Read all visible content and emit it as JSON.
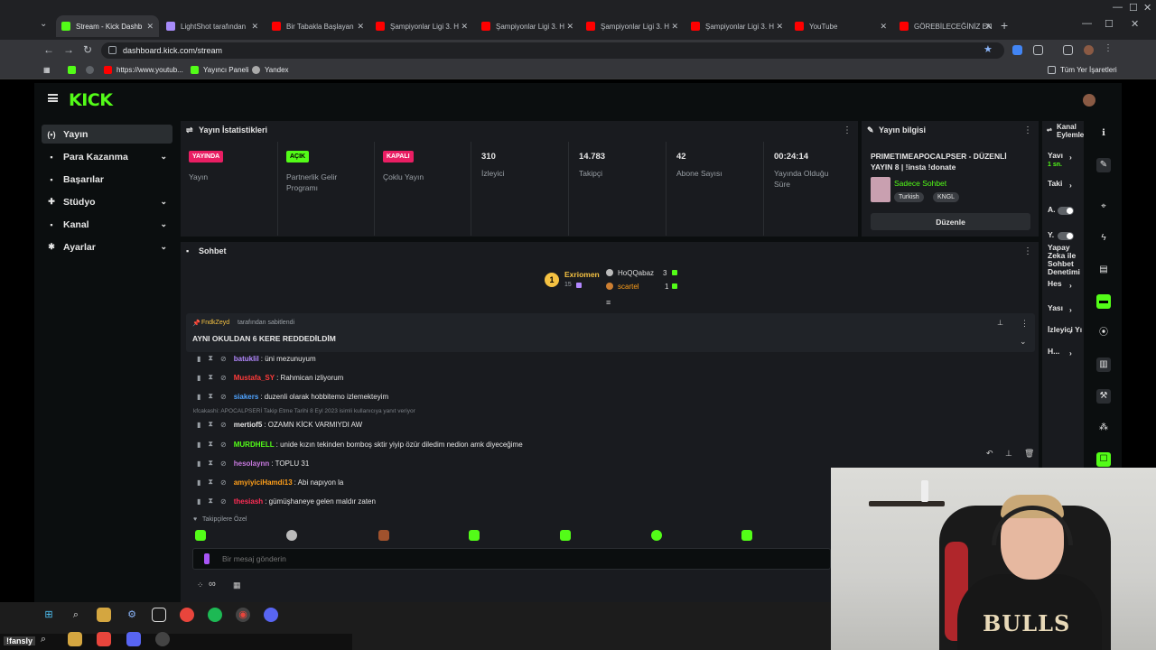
{
  "browser": {
    "tabs": [
      {
        "title": "Stream - Kick Dashb",
        "color": "#53fc18",
        "active": true
      },
      {
        "title": "LightShot tarafından",
        "color": "#a78bfa",
        "active": false
      },
      {
        "title": "Bir Tabakla Başlayan",
        "color": "#ff0000",
        "active": false
      },
      {
        "title": "Şampiyonlar Ligi 3. H",
        "color": "#ff0000",
        "active": false
      },
      {
        "title": "Şampiyonlar Ligi 3. H",
        "color": "#ff0000",
        "active": false
      },
      {
        "title": "Şampiyonlar Ligi 3. H",
        "color": "#ff0000",
        "active": false
      },
      {
        "title": "Şampiyonlar Ligi 3. H",
        "color": "#ff0000",
        "active": false
      },
      {
        "title": "YouTube",
        "color": "#ff0000",
        "active": false
      },
      {
        "title": "GÖREBİLECEĞİNİZ EN",
        "color": "#ff0000",
        "active": false
      }
    ],
    "url": "dashboard.kick.com/stream",
    "bookmarks": [
      "https://www.youtub...",
      "Yayıncı Paneli",
      "Yandex"
    ],
    "all_bookmarks": "Tüm Yer İşaretleri"
  },
  "sidebar": {
    "items": [
      {
        "label": "Yayın",
        "icon": "broadcast-icon",
        "glyph": "(•)",
        "chevron": false
      },
      {
        "label": "Para Kazanma",
        "icon": "money-icon",
        "glyph": "▪",
        "chevron": true
      },
      {
        "label": "Başarılar",
        "icon": "trophy-icon",
        "glyph": "▪",
        "chevron": false
      },
      {
        "label": "Stüdyo",
        "icon": "studio-icon",
        "glyph": "✚",
        "chevron": true
      },
      {
        "label": "Kanal",
        "icon": "channel-icon",
        "glyph": "▪",
        "chevron": true
      },
      {
        "label": "Ayarlar",
        "icon": "gear-icon",
        "glyph": "✱",
        "chevron": true
      }
    ]
  },
  "stats": {
    "title": "Yayın İstatistikleri",
    "cols": [
      {
        "badge": "YAYINDA",
        "badge_color": "#e91e63",
        "label": "Yayın"
      },
      {
        "badge": "AÇIK",
        "badge_color": "#53fc18",
        "label": "Partnerlik Gelir Programı"
      },
      {
        "badge": "KAPALI",
        "badge_color": "#e91e63",
        "label": "Çoklu Yayın"
      },
      {
        "value": "310",
        "label": "İzleyici"
      },
      {
        "value": "14.783",
        "label": "Takipçi"
      },
      {
        "value": "42",
        "label": "Abone Sayısı"
      },
      {
        "value": "00:24:14",
        "label": "Yayında Olduğu Süre"
      }
    ]
  },
  "info": {
    "title": "Yayın bilgisi",
    "stream_title": "PRIMETIMEAPOCALPSER - DÜZENLİ YAYIN 8 | !insta !donate",
    "category": "Sadece Sohbet",
    "tags": [
      "Turkish",
      "KNGL"
    ],
    "edit_button": "Düzenle"
  },
  "actions": {
    "title": "Kanal Eylemle",
    "items": [
      {
        "label": "Yavı",
        "sub": "1 sn."
      },
      {
        "label": "Taki"
      },
      {
        "label": "A."
      },
      {
        "label": "Y."
      },
      {
        "label": "Yapay Zeka ile Sohbet Denetimi"
      },
      {
        "label": "Hes"
      },
      {
        "label": "Yası"
      },
      {
        "label": "İzleyici Yı"
      },
      {
        "label": "H..."
      }
    ]
  },
  "chat": {
    "title": "Sohbet",
    "leaderboard": {
      "first": {
        "rank": "1",
        "name": "Exriomen",
        "count": "15"
      },
      "second": {
        "name": "HoQQabaz",
        "count": "3"
      },
      "third": {
        "name": "scartel",
        "count": "1"
      }
    },
    "pinned": {
      "by_user": "FndkZeyd",
      "by_text": "tarafından sabitlendi",
      "text": "AYNI OKULDAN 6 KERE REDDEDİLDİM"
    },
    "messages": [
      {
        "user": "batuklil",
        "color": "#b388ff",
        "text": ": üni mezunuyum"
      },
      {
        "user": "Mustafa_SY",
        "color": "#ff3b3b",
        "text": ": Rahmican izliyorum"
      },
      {
        "user": "siakers",
        "color": "#4fa3ff",
        "text": ": duzenli olarak hobbitemo izlemekteyim"
      },
      {
        "reply": "kfcakashi: APOCALPSERİ Takip Etme Tarihi 8 Eyl 2023 isimli kullanıcıya yanıt veriyor"
      },
      {
        "user": "mertiof5",
        "color": "#e6e6e6",
        "text": ": OZAMN KİCK VARMIYDI AW"
      },
      {
        "user": "MURDHELL",
        "color": "#53fc18",
        "text": ": unide kızın tekinden bomboş sktir yiyip özür diledim nedion amk diyeceğime"
      },
      {
        "user": "hesolaynn",
        "color": "#c678dd",
        "text": ": TOPLU 31"
      },
      {
        "user": "amyiyiciHamdi13",
        "color": "#ff9f1a",
        "text": ": Abi napıyon la"
      },
      {
        "user": "thesiash",
        "color": "#ff2d55",
        "text": ": gümüşhaneye gelen maldır zaten"
      }
    ],
    "emote_section": "Takipçilere Özel",
    "input_placeholder": "Bir mesaj gönderin",
    "bottom_left": "∞"
  },
  "overlay": {
    "ticker": "!fansly"
  }
}
